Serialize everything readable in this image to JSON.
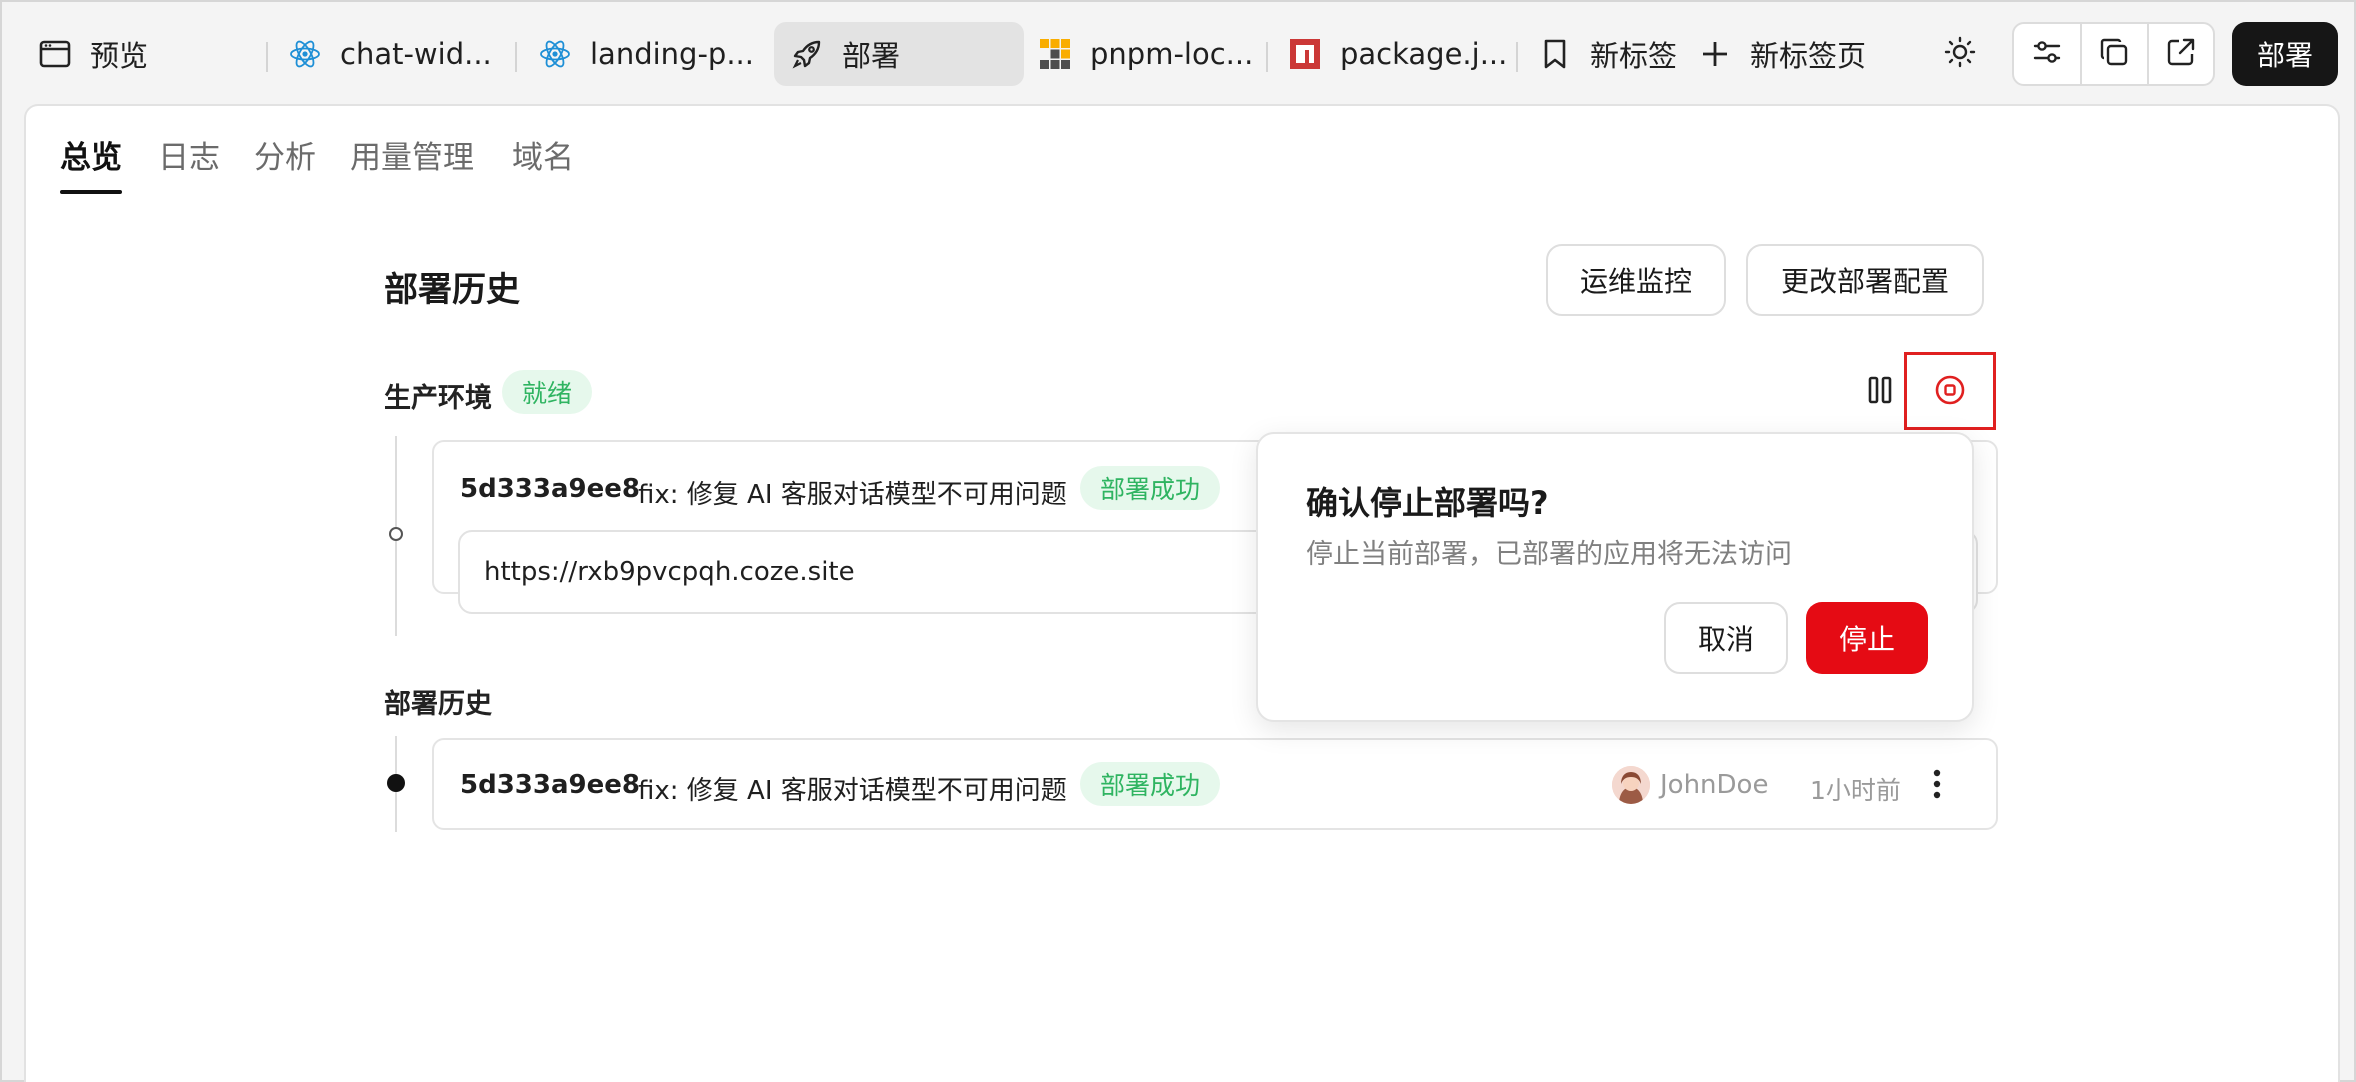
{
  "tabs": [
    {
      "label": "预览",
      "icon": "browser-window-icon"
    },
    {
      "label": "chat-wid...",
      "icon": "react-icon"
    },
    {
      "label": "landing-p...",
      "icon": "react-icon"
    },
    {
      "label": "部署",
      "icon": "rocket-icon",
      "active": true
    },
    {
      "label": "pnpm-loc...",
      "icon": "pnpm-icon"
    },
    {
      "label": "package.j...",
      "icon": "npm-icon"
    },
    {
      "label": "新标签",
      "icon": "bookmark-icon"
    },
    {
      "label": "新标签页",
      "icon": "plus-icon"
    }
  ],
  "toolbar": {
    "deploy_label": "部署"
  },
  "subtabs": [
    "总览",
    "日志",
    "分析",
    "用量管理",
    "域名"
  ],
  "page": {
    "title": "部署历史",
    "monitor_button": "运维监控",
    "config_button": "更改部署配置"
  },
  "production": {
    "label": "生产环境",
    "status": "就绪",
    "hash": "5d333a9ee8",
    "message": "fix: 修复 AI 客服对话模型不可用问题",
    "badge": "部署成功",
    "url": "https://rxb9pvcpqh.coze.site"
  },
  "history": {
    "label": "部署历史",
    "items": [
      {
        "hash": "5d333a9ee8",
        "message": "fix: 修复 AI 客服对话模型不可用问题",
        "badge": "部署成功",
        "user": "JohnDoe",
        "time": "1小时前"
      }
    ]
  },
  "popover": {
    "title": "确认停止部署吗?",
    "description": "停止当前部署，已部署的应用将无法访问",
    "cancel": "取消",
    "confirm": "停止"
  },
  "colors": {
    "accent_danger": "#e50b14",
    "success_text": "#2fb461",
    "success_bg": "#e6f8ec",
    "highlight_border": "#e02020"
  }
}
